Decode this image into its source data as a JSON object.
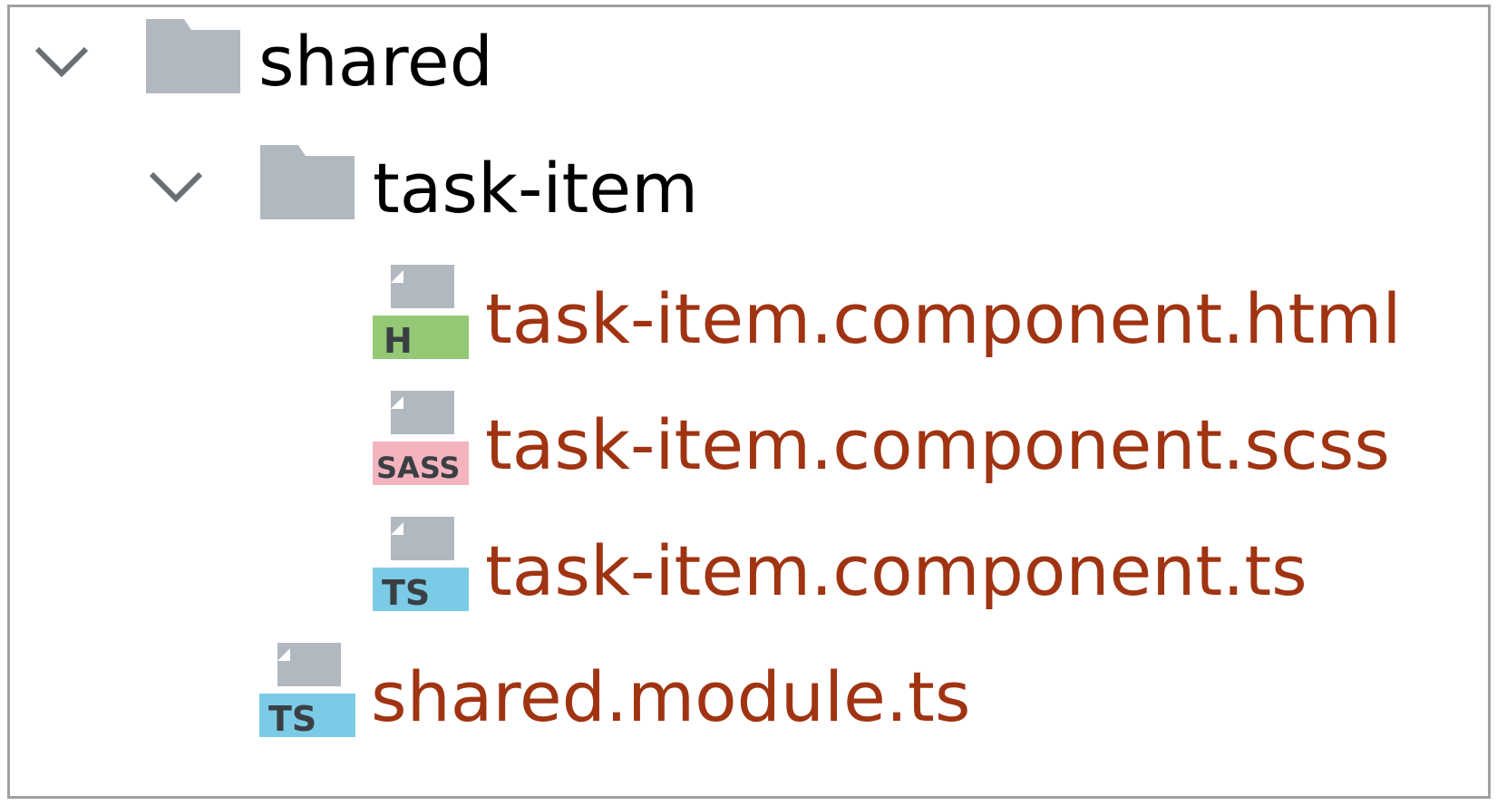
{
  "colors": {
    "folder_text": "#000000",
    "file_text": "#a03412",
    "folder_icon": "#b1b8c0",
    "html_badge": "#93c975",
    "sass_badge": "#f4b4be",
    "ts_badge": "#7ccbe6",
    "badge_text": "#3a3f44",
    "chevron": "#6b6f74"
  },
  "tree": {
    "shared": {
      "label": "shared",
      "expand_icon": "chevron-down-icon",
      "icon": "folder-icon"
    },
    "task_item": {
      "label": "task-item",
      "expand_icon": "chevron-down-icon",
      "icon": "folder-icon"
    },
    "files": [
      {
        "label": "task-item.component.html",
        "badge": "H",
        "icon": "html-file-icon"
      },
      {
        "label": "task-item.component.scss",
        "badge": "SASS",
        "icon": "sass-file-icon"
      },
      {
        "label": "task-item.component.ts",
        "badge": "TS",
        "icon": "ts-file-icon"
      }
    ],
    "module": {
      "label": "shared.module.ts",
      "badge": "TS",
      "icon": "ts-file-icon"
    }
  }
}
